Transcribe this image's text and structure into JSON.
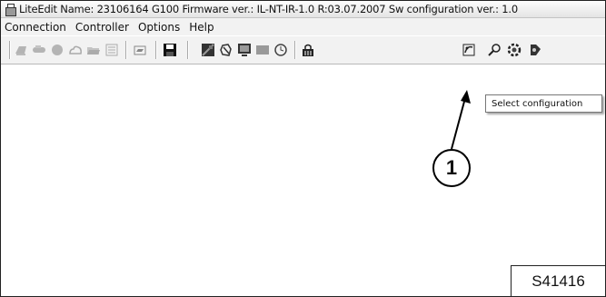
{
  "window": {
    "title": "LiteEdit Name: 23106164 G100 Firmware ver.: IL-NT-IR-1.0 R:03.07.2007 Sw configuration ver.: 1.0",
    "app_icon": "liteedit-app-icon"
  },
  "menu": {
    "items": [
      "Connection",
      "Controller",
      "Options",
      "Help"
    ]
  },
  "toolbar": {
    "buttons": [
      "open-connection-icon",
      "direct-connection-icon",
      "modem-connection-icon",
      "internet-connection-icon",
      "open-archive-icon",
      "offline-icon",
      "print-icon",
      "save-icon",
      "history-icon",
      "values-icon",
      "monitor-icon",
      "setpoints-icon",
      "clock-icon",
      "controller-lock-icon",
      "select-configuration-icon",
      "find-icon",
      "settings-gear-icon",
      "tools-icon"
    ]
  },
  "tooltip": {
    "text": "Select configuration"
  },
  "callout": {
    "number": "1"
  },
  "figure": {
    "id": "S41416"
  }
}
